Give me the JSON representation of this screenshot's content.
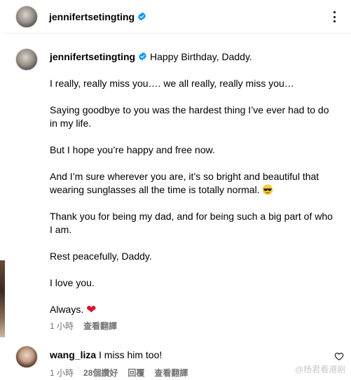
{
  "header": {
    "username": "jennifertsetingting",
    "verified": true,
    "more_icon": "more-horizontal-icon"
  },
  "post": {
    "username": "jennifertsetingting",
    "caption_first": "Happy Birthday, Daddy.",
    "paragraphs": [
      "I really, really miss you…. we all really, really miss you…",
      "Saying goodbye to you was the hardest thing I’ve ever had to do in my life.",
      "But I hope you’re happy and free now.",
      "And I’m sure wherever you are, it’s so bright and beautiful that wearing sunglasses all the time is totally normal.",
      "Thank you for being my dad, and for being such a big part of who I am.",
      "Rest peacefully, Daddy.",
      "I love you.",
      "Always."
    ],
    "emoji_sunglasses": "sunglasses-emoji",
    "emoji_heart": "❤",
    "time": "1 小時",
    "see_translation": "查看翻譯"
  },
  "comment": {
    "username": "wang_liza",
    "text": "I miss him too!",
    "time": "1 小時",
    "likes": "28個讚好",
    "reply": "回覆",
    "see_translation": "查看翻譯"
  },
  "watermark": "@杨君看港剧",
  "colors": {
    "verified_blue": "#0095f6",
    "meta_gray": "#737373",
    "heart_red": "#e0102a"
  }
}
